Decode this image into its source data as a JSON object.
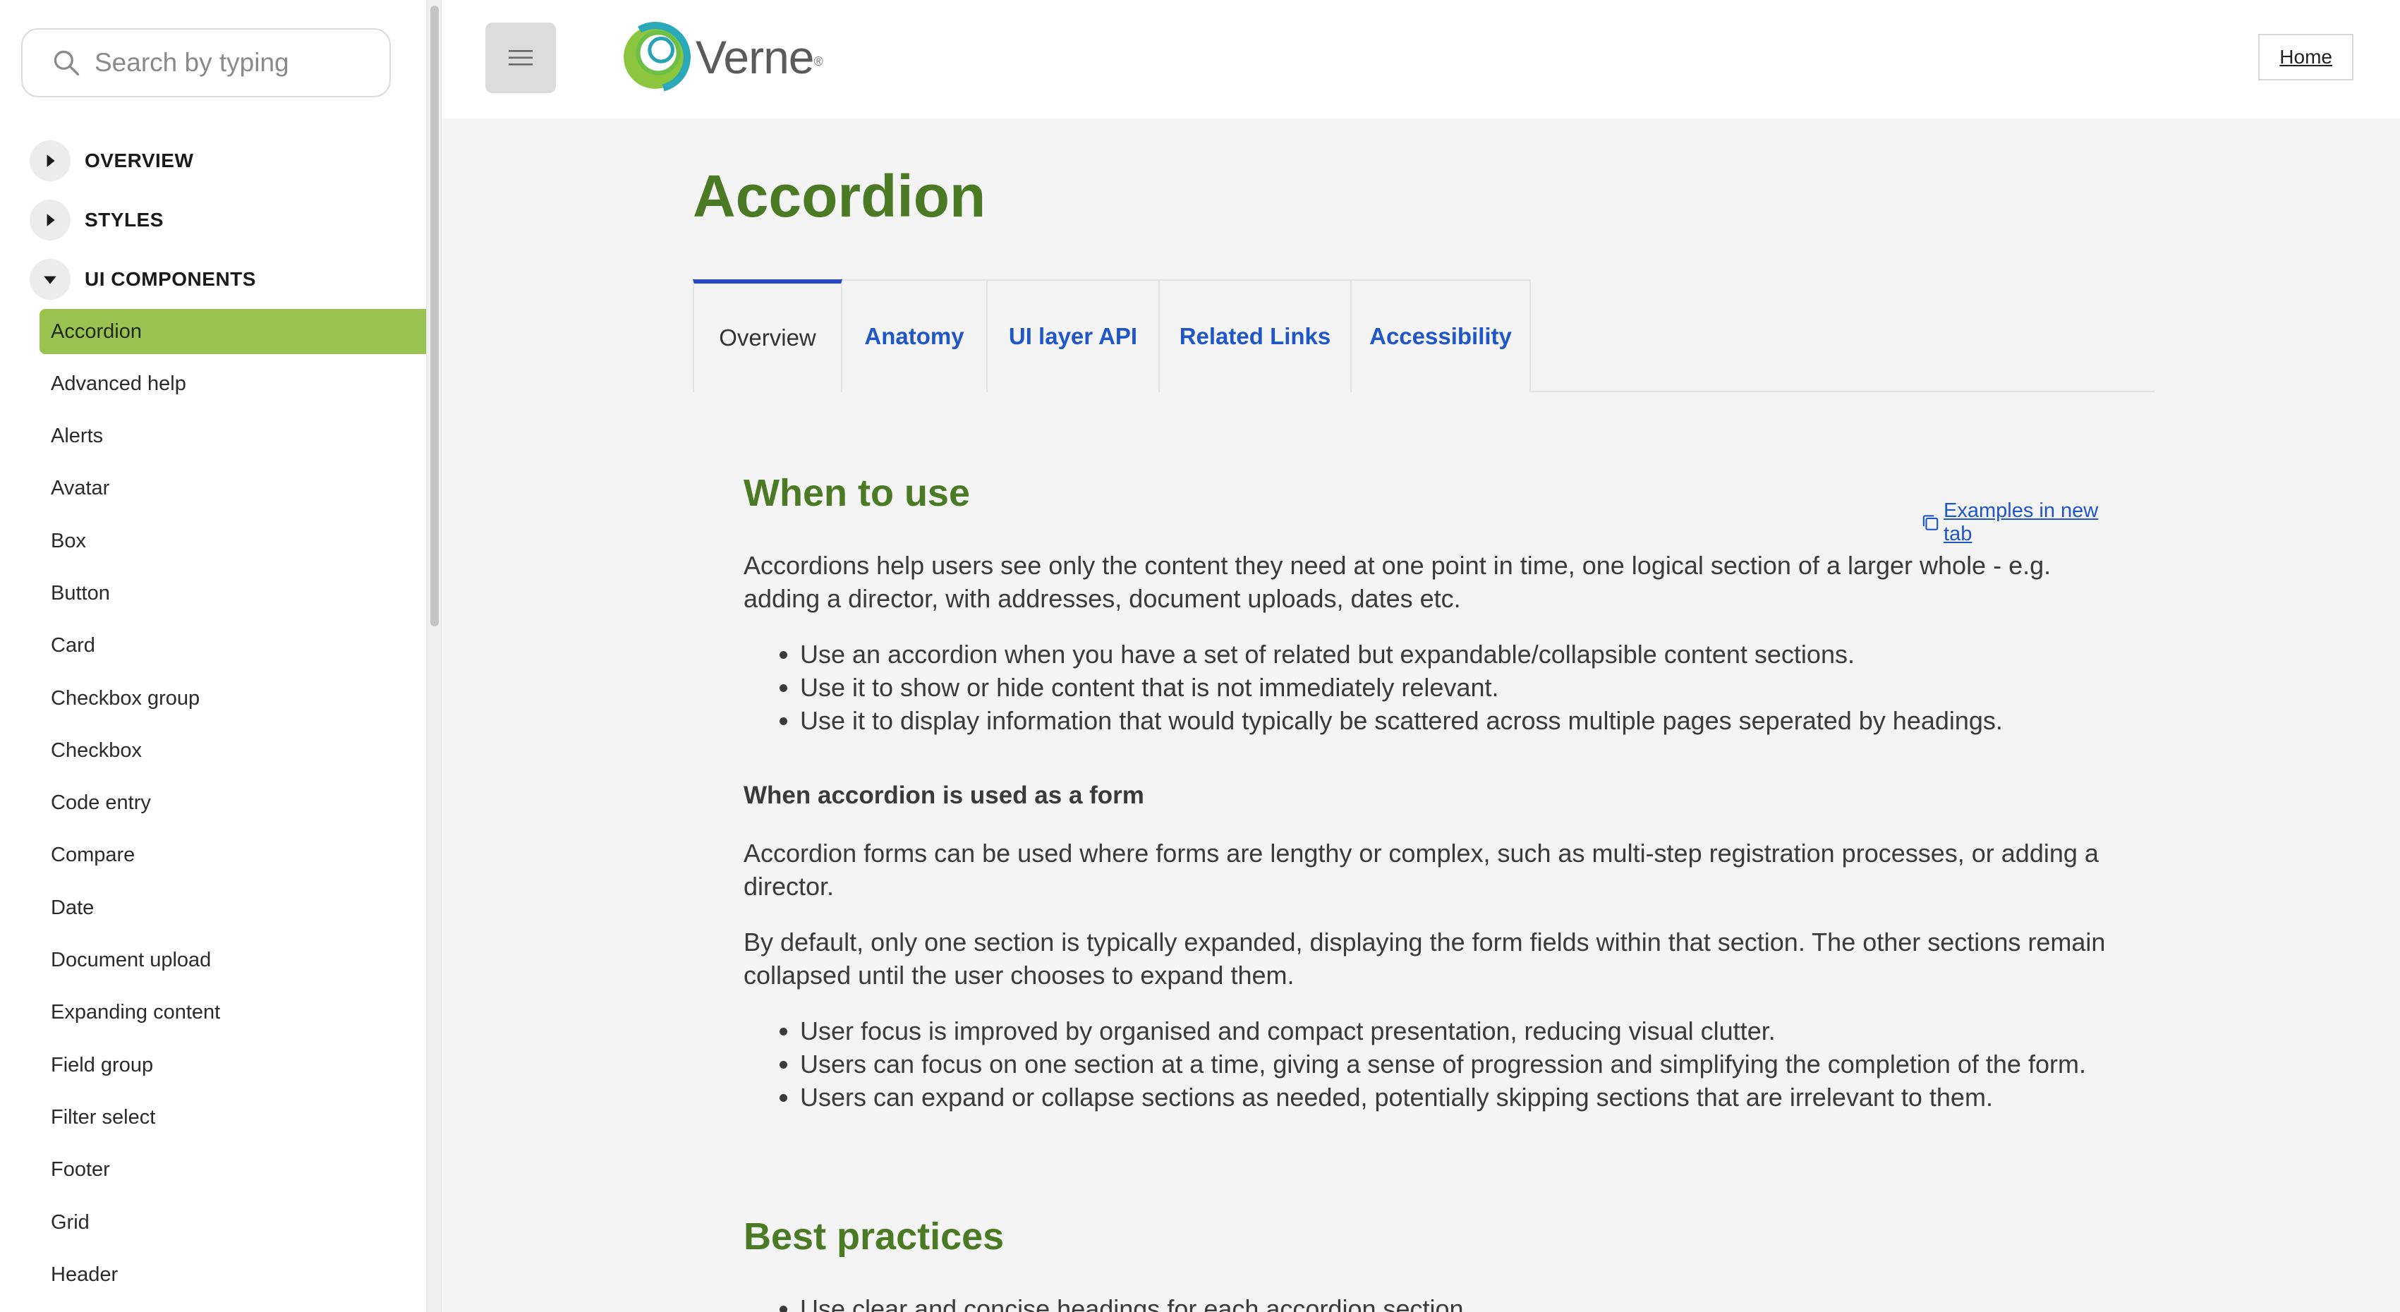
{
  "sidebar": {
    "search_placeholder": "Search by typing",
    "sections": [
      {
        "label": "OVERVIEW",
        "expanded": false
      },
      {
        "label": "STYLES",
        "expanded": false
      },
      {
        "label": "UI COMPONENTS",
        "expanded": true
      }
    ],
    "items": [
      {
        "label": "Accordion",
        "active": true
      },
      {
        "label": "Advanced help"
      },
      {
        "label": "Alerts"
      },
      {
        "label": "Avatar"
      },
      {
        "label": "Box"
      },
      {
        "label": "Button"
      },
      {
        "label": "Card"
      },
      {
        "label": "Checkbox group"
      },
      {
        "label": "Checkbox"
      },
      {
        "label": "Code entry"
      },
      {
        "label": "Compare"
      },
      {
        "label": "Date"
      },
      {
        "label": "Document upload"
      },
      {
        "label": "Expanding content"
      },
      {
        "label": "Field group"
      },
      {
        "label": "Filter select"
      },
      {
        "label": "Footer"
      },
      {
        "label": "Grid"
      },
      {
        "label": "Header"
      }
    ],
    "active_color": "#9bc352"
  },
  "header": {
    "logo_text": "Verne",
    "logo_reg": "®",
    "home_label": "Home",
    "menu_icon": "hamburger-icon"
  },
  "main": {
    "title": "Accordion",
    "tabs": [
      {
        "label": "Overview",
        "active": true
      },
      {
        "label": "Anatomy"
      },
      {
        "label": "UI layer API"
      },
      {
        "label": "Related Links"
      },
      {
        "label": "Accessibility"
      }
    ],
    "when_to_use": {
      "heading": "When to use",
      "examples_link": "Examples in new tab",
      "intro": "Accordions help users see only the content they need at one point in time, one logical section of a larger whole - e.g. adding a director, with addresses, document uploads, dates etc.",
      "bullets": [
        "Use an accordion when you have a set of related but expandable/collapsible content sections.",
        "Use it to show or hide content that is not immediately relevant.",
        "Use it to display information that would typically be scattered across multiple pages seperated by headings."
      ]
    },
    "as_form": {
      "heading": "When accordion is used as a form",
      "para1": "Accordion forms can be used where forms are lengthy or complex, such as multi-step registration processes, or adding a director.",
      "para2": "By default, only one section is typically expanded, displaying the form fields within that section. The other sections remain collapsed until the user chooses to expand them.",
      "bullets": [
        "User focus is improved by organised and compact presentation, reducing visual clutter.",
        "Users can focus on one section at a time, giving a sense of progression and simplifying the completion of the form.",
        "Users can expand or collapse sections as needed, potentially skipping sections that are irrelevant to them."
      ]
    },
    "best_practices": {
      "heading": "Best practices",
      "bullets": [
        "Use clear and concise headings for each accordion section."
      ]
    }
  },
  "colors": {
    "accent_green": "#4b7a24",
    "link_blue": "#1f56c8",
    "active_tab_border": "#2a4bbf",
    "background": "#f4f4f5"
  }
}
